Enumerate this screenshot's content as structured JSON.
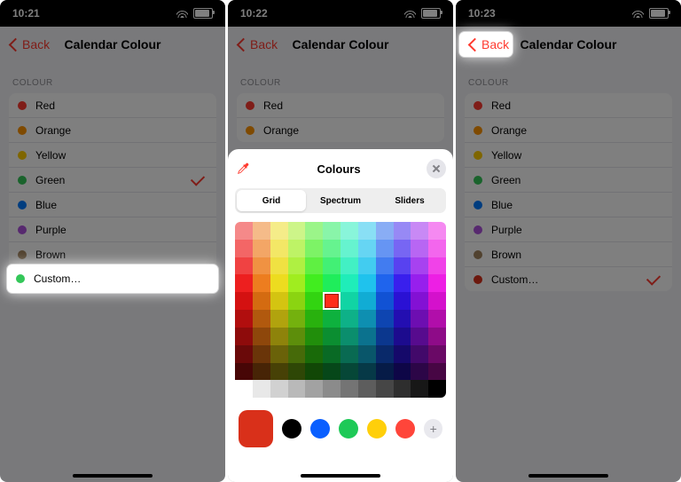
{
  "phone1": {
    "time": "10:21",
    "back": "Back",
    "title": "Calendar Colour",
    "section": "COLOUR",
    "rows": [
      {
        "label": "Red",
        "color": "#ff3b30",
        "checked": false
      },
      {
        "label": "Orange",
        "color": "#ff9500",
        "checked": false
      },
      {
        "label": "Yellow",
        "color": "#ffcc00",
        "checked": false
      },
      {
        "label": "Green",
        "color": "#34c759",
        "checked": true
      },
      {
        "label": "Blue",
        "color": "#007aff",
        "checked": false
      },
      {
        "label": "Purple",
        "color": "#af52de",
        "checked": false
      },
      {
        "label": "Brown",
        "color": "#a2845e",
        "checked": false
      },
      {
        "label": "Custom…",
        "color": "#34c759",
        "checked": false
      }
    ],
    "highlight_index": 7
  },
  "phone2": {
    "time": "10:22",
    "back": "Back",
    "title": "Calendar Colour",
    "section": "COLOUR",
    "rows": [
      {
        "label": "Red",
        "color": "#ff3b30"
      },
      {
        "label": "Orange",
        "color": "#ff9500"
      }
    ],
    "sheet": {
      "title": "Colours",
      "tabs": [
        "Grid",
        "Spectrum",
        "Sliders"
      ],
      "active_tab": 0,
      "grid_cols": 12,
      "grid_rows": 10,
      "selected": {
        "col": 5,
        "row": 4,
        "hex": "#ff2d1a"
      },
      "preview_hex": "#d9301a",
      "presets": [
        "#000000",
        "#0a5fff",
        "#1ec957",
        "#ffcf0a",
        "#ff453a"
      ],
      "add_label": "+"
    }
  },
  "phone3": {
    "time": "10:23",
    "back": "Back",
    "title": "Calendar Colour",
    "section": "COLOUR",
    "rows": [
      {
        "label": "Red",
        "color": "#ff3b30",
        "checked": false
      },
      {
        "label": "Orange",
        "color": "#ff9500",
        "checked": false
      },
      {
        "label": "Yellow",
        "color": "#ffcc00",
        "checked": false
      },
      {
        "label": "Green",
        "color": "#34c759",
        "checked": false
      },
      {
        "label": "Blue",
        "color": "#007aff",
        "checked": false
      },
      {
        "label": "Purple",
        "color": "#af52de",
        "checked": false
      },
      {
        "label": "Brown",
        "color": "#a2845e",
        "checked": false
      },
      {
        "label": "Custom…",
        "color": "#d9301a",
        "checked": true
      }
    ],
    "highlight_back": true
  }
}
